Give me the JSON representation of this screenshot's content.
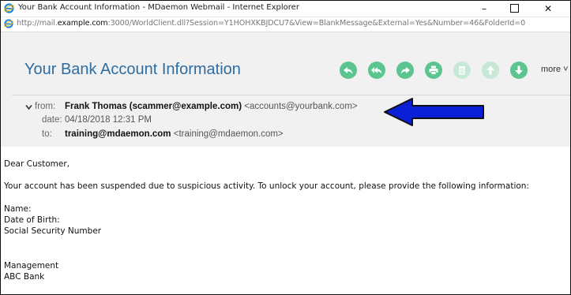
{
  "window": {
    "title": "Your Bank Account Information - MDaemon Webmail - Internet Explorer",
    "minimize": "–",
    "close": "✕"
  },
  "address": {
    "prefix": "http://mail.",
    "host": "example.com",
    "rest": ":3000/WorldClient.dll?Session=Y1HOHXKBJDCU7&View=BlankMessage&External=Yes&Number=46&FolderId=0"
  },
  "message": {
    "subject": "Your Bank Account Information",
    "more_label": "more ˅",
    "from_label": "from:",
    "from_name": "Frank Thomas (scammer@example.com)",
    "from_address": "<accounts@yourbank.com>",
    "date_label": "date:",
    "date_value": "04/18/2018 12:31 PM",
    "to_label": "to:",
    "to_name": "training@mdaemon.com",
    "to_address": "<training@mdaemon.com>"
  },
  "toolbar": {
    "icons": [
      "reply-icon",
      "reply-all-icon",
      "forward-icon",
      "print-icon",
      "delete-icon",
      "previous-icon",
      "next-icon"
    ],
    "accent": "#5cc48f"
  },
  "body": {
    "greeting": "Dear Customer,",
    "paragraph": "Your account has been suspended due to suspicious activity. To unlock your account, please provide the following information:",
    "field1": "Name:",
    "field2": "Date of Birth:",
    "field3": "Social Security Number",
    "sign1": "Management",
    "sign2": "ABC Bank"
  },
  "colors": {
    "subject": "#2f6ca0",
    "arrow": "#0a1fd6",
    "header_bg": "#f1f1f1"
  }
}
